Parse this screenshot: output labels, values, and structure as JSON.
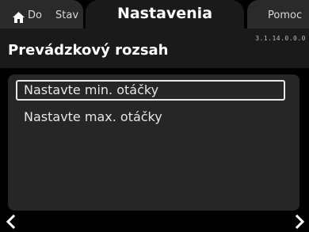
{
  "tabs": {
    "home_label": "Do",
    "stav_label": "Stav",
    "active_label": "Nastavenia",
    "help_label": "Pomoc"
  },
  "header": {
    "version": "3.1.14.0.0.0",
    "title": "Prevádzkový rozsah"
  },
  "menu": {
    "items": [
      {
        "label": "Nastavte min. otáčky",
        "selected": true
      },
      {
        "label": "Nastavte max. otáčky",
        "selected": false
      }
    ]
  },
  "icons": {
    "home": "home-icon",
    "prev": "chevron-left-icon",
    "next": "chevron-right-icon"
  },
  "colors": {
    "background": "#000000",
    "panel": "#262626",
    "tab": "#2a2a2a",
    "selection_border": "#e8e8e8"
  }
}
